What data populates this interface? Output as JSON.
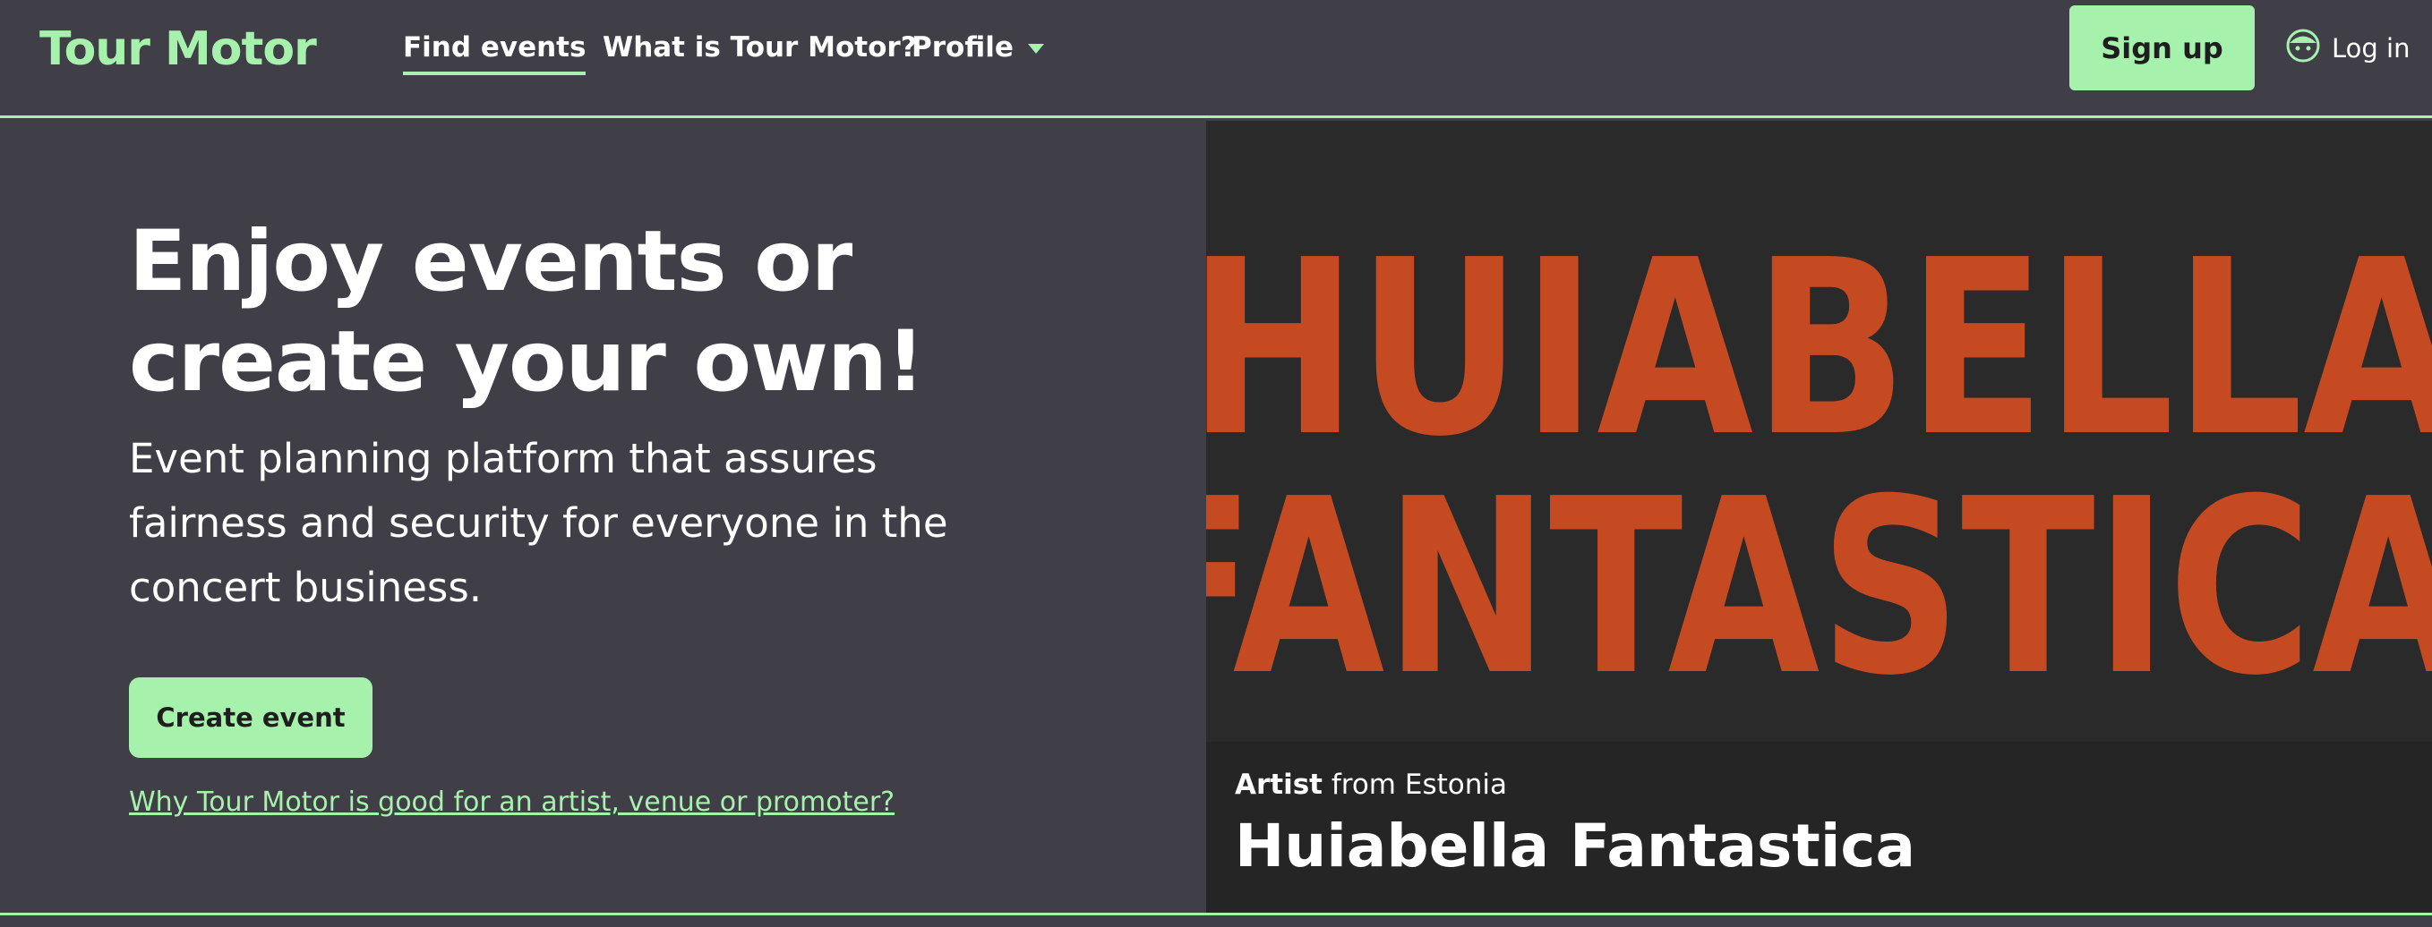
{
  "header": {
    "logo": "Tour Motor",
    "nav": [
      {
        "label": "Find events",
        "active": true
      },
      {
        "label": "What is Tour Motor?",
        "active": false
      },
      {
        "label": "Profile",
        "has_dropdown": true
      }
    ],
    "signup_label": "Sign up",
    "login_label": "Log in",
    "login_icon": "user-face-icon"
  },
  "hero": {
    "title": "Enjoy events or create your own!",
    "subtitle": "Event planning platform that assures fairness and security for everyone in the concert business.",
    "create_button": "Create event",
    "why_link": "Why Tour Motor is good for an artist, venue or promoter?"
  },
  "featured_artist": {
    "image_text_line1": "HUIABELLA",
    "image_text_line2": "FANTASTICA",
    "role": "Artist",
    "origin": "from Estonia",
    "name": "Huiabella Fantastica"
  },
  "colors": {
    "background": "#403e46",
    "accent": "#a6f2ad",
    "image_text": "#c54a22",
    "card_dark": "#252525"
  }
}
